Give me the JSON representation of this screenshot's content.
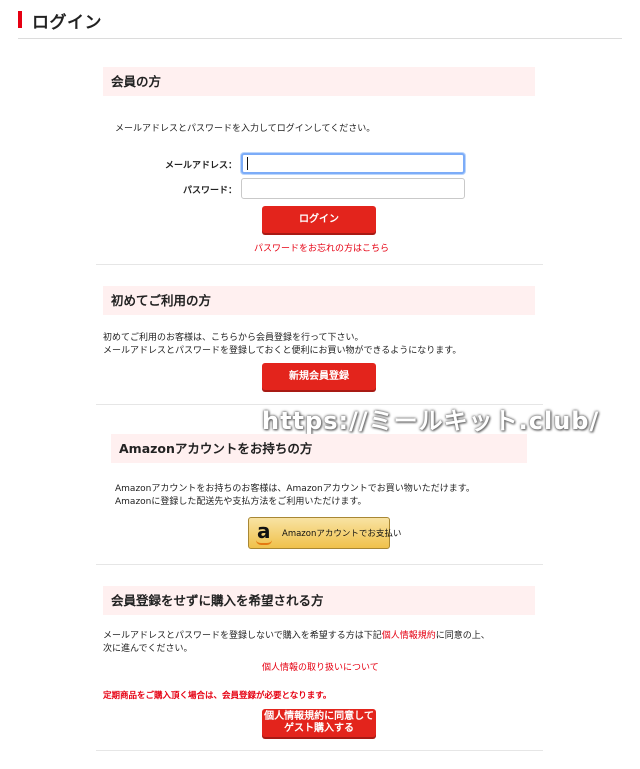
{
  "page": {
    "title": "ログイン"
  },
  "member": {
    "heading": "会員の方",
    "instruction": "メールアドレスとパスワードを入力してログインしてください。",
    "email_label": "メールアドレス：",
    "email_value": "",
    "password_label": "パスワード：",
    "password_value": "",
    "login_button": "ログイン",
    "forgot_link": "パスワードをお忘れの方はこちら"
  },
  "first_time": {
    "heading": "初めてご利用の方",
    "text_lines": [
      "初めてご利用のお客様は、こちらから会員登録を行って下さい。",
      "メールアドレスとパスワードを登録しておくと便利にお買い物ができるようになります。"
    ],
    "register_button": "新規会員登録"
  },
  "watermark": "https://ミールキット.club/",
  "amazon": {
    "heading": "Amazonアカウントをお持ちの方",
    "text_lines": [
      "Amazonアカウントをお持ちのお客様は、Amazonアカウントでお買い物いただけます。",
      "Amazonに登録した配送先や支払方法をご利用いただけます。"
    ],
    "pay_button_label": "Amazonアカウントでお支払い",
    "logo_letter": "a"
  },
  "guest": {
    "heading": "会員登録をせずに購入を希望される方",
    "text_line1_before": "メールアドレスとパスワードを登録しないで購入を希望する方は下記",
    "text_line1_link": "個人情報規約",
    "text_line1_after": "に同意の上、",
    "text_line2": "次に進んでください。",
    "privacy_link": "個人情報の取り扱いについて",
    "warning": "定期商品をご購入頂く場合は、会員登録が必要となります。",
    "guest_button_line1": "個人情報規約に同意して",
    "guest_button_line2": "ゲスト購入する"
  },
  "colors": {
    "accent": "#e60012",
    "button": "#e3241c",
    "section_bg": "#fff0f0",
    "amazon_yellow": "#f0c14b"
  }
}
